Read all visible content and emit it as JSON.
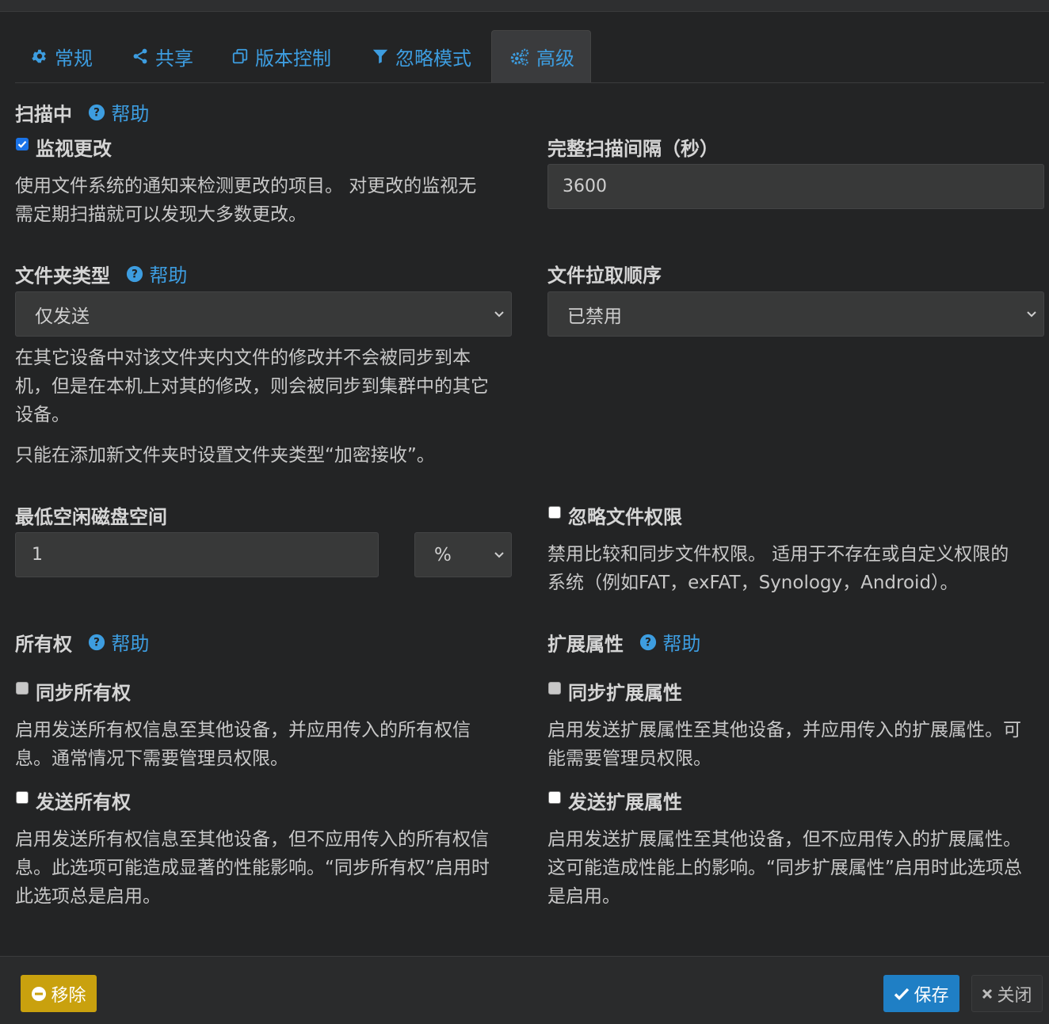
{
  "tabs": [
    {
      "label": "常规"
    },
    {
      "label": "共享"
    },
    {
      "label": "版本控制"
    },
    {
      "label": "忽略模式"
    },
    {
      "label": "高级"
    }
  ],
  "help_label": "帮助",
  "scanning": {
    "title": "扫描中",
    "watch_label": "监视更改",
    "watch_desc_1": "使用文件系统的通知来检测更改的项目。 对更改的监视无",
    "watch_desc_2": "需定期扫描就可以发现大多数更改。",
    "interval_label": "完整扫描间隔（秒）",
    "interval_value": "3600"
  },
  "folder_type": {
    "title": "文件夹类型",
    "value": "仅发送",
    "desc_1": "在其它设备中对该文件夹内文件的修改并不会被同步到本",
    "desc_2": "机，但是在本机上对其的修改，则会被同步到集群中的其它",
    "desc_3": "设备。",
    "desc_4": "只能在添加新文件夹时设置文件夹类型“加密接收”。"
  },
  "pull_order": {
    "title": "文件拉取顺序",
    "value": "已禁用"
  },
  "min_disk": {
    "title": "最低空闲磁盘空间",
    "value": "1",
    "unit": "%"
  },
  "ignore_perms": {
    "label": "忽略文件权限",
    "desc_1": "禁用比较和同步文件权限。 适用于不存在或自定义权限的",
    "desc_2": "系统（例如FAT，exFAT，Synology，Android）。"
  },
  "ownership": {
    "title": "所有权",
    "sync_label": "同步所有权",
    "sync_desc_1": "启用发送所有权信息至其他设备，并应用传入的所有权信",
    "sync_desc_2": "息。通常情况下需要管理员权限。",
    "send_label": "发送所有权",
    "send_desc_1": "启用发送所有权信息至其他设备，但不应用传入的所有权信",
    "send_desc_2": "息。此选项可能造成显著的性能影响。“同步所有权”启用时",
    "send_desc_3": "此选项总是启用。"
  },
  "xattrs": {
    "title": "扩展属性",
    "sync_label": "同步扩展属性",
    "sync_desc_1": "启用发送扩展属性至其他设备，并应用传入的扩展属性。可",
    "sync_desc_2": "能需要管理员权限。",
    "send_label": "发送扩展属性",
    "send_desc_1": "启用发送扩展属性至其他设备，但不应用传入的扩展属性。",
    "send_desc_2": "这可能造成性能上的影响。“同步扩展属性”启用时此选项总",
    "send_desc_3": "是启用。"
  },
  "footer": {
    "remove": "移除",
    "save": "保存",
    "close": "关闭"
  },
  "colors": {
    "background": "#232425",
    "link": "#3d9de0",
    "warning_button": "#c9a10e",
    "primary_button": "#1f7fc5"
  }
}
